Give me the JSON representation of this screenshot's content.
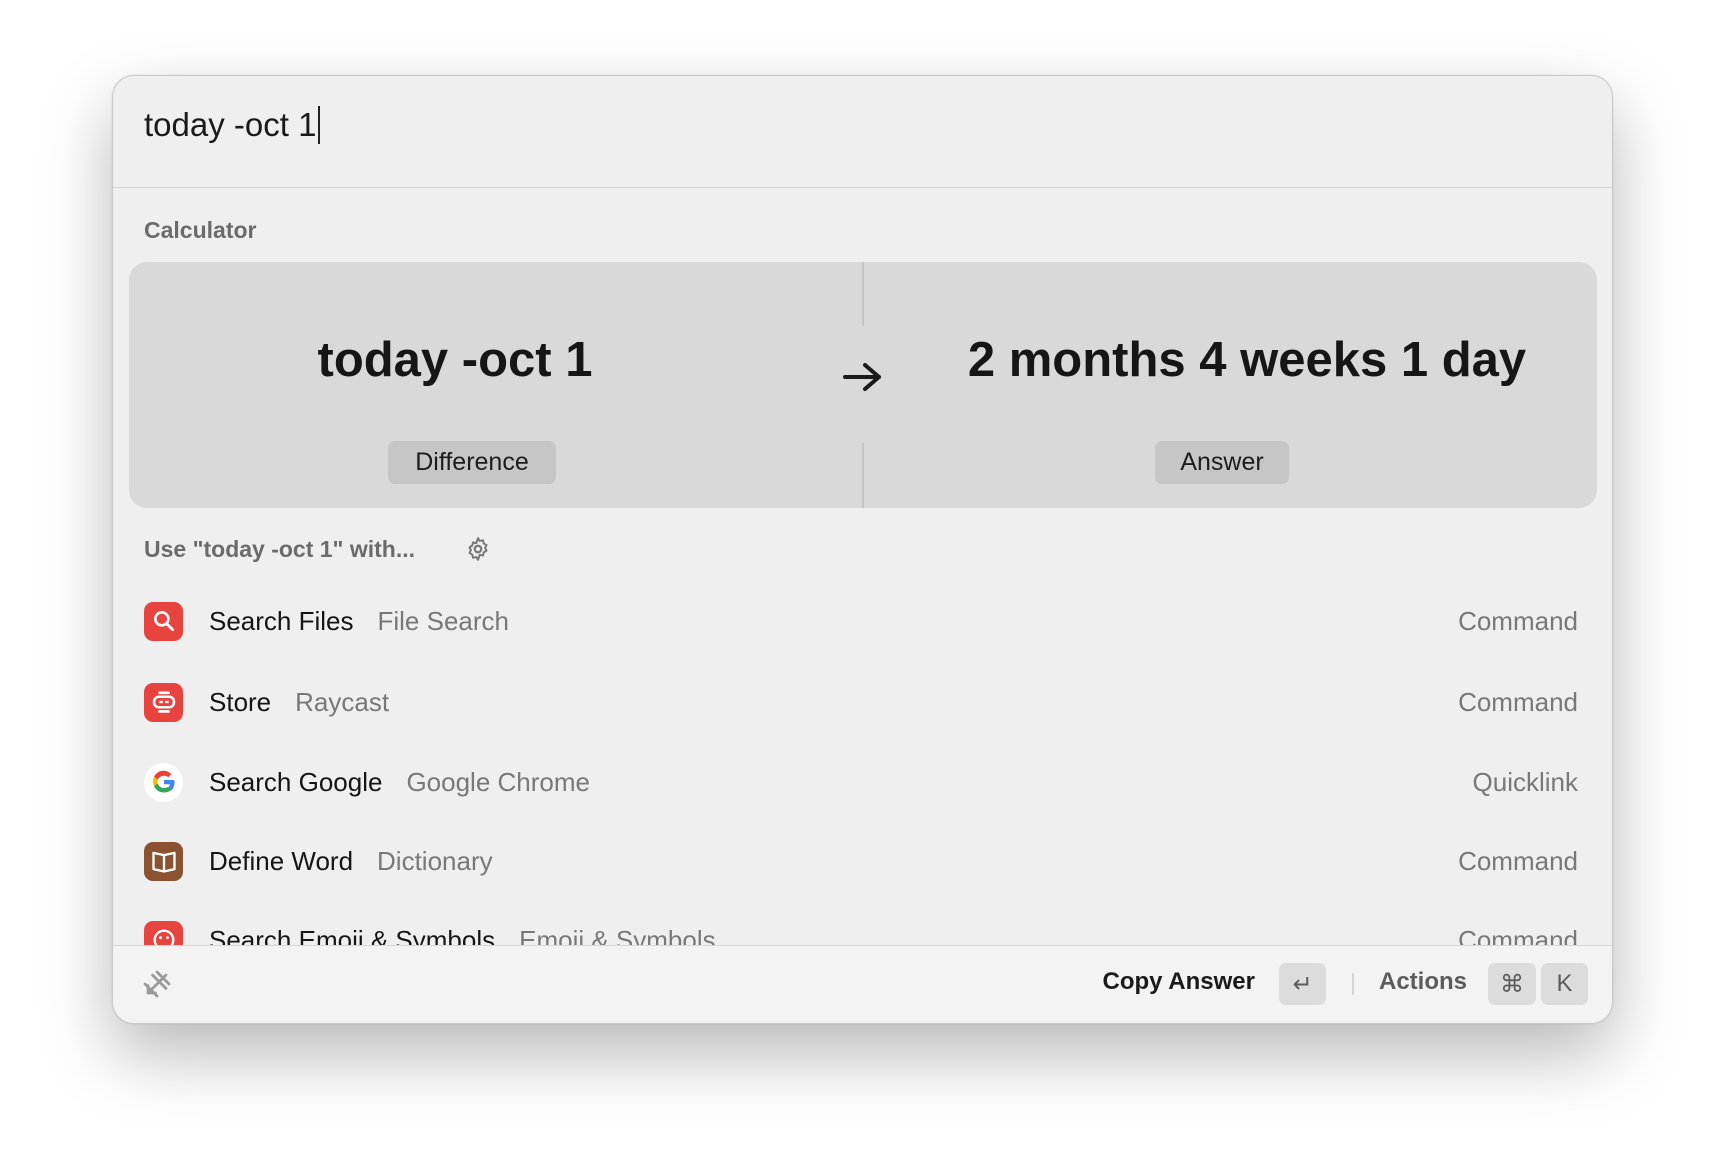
{
  "search": {
    "query": "today -oct 1"
  },
  "calculator": {
    "section_label": "Calculator",
    "expression": "today -oct 1",
    "expression_label": "Difference",
    "result": "2 months 4 weeks 1 day",
    "result_label": "Answer"
  },
  "fallback": {
    "label": "Use \"today -oct 1\" with..."
  },
  "items": [
    {
      "title": "Search Files",
      "subtitle": "File Search",
      "kind": "Command",
      "icon": "search-files-icon",
      "color": "#e8443f"
    },
    {
      "title": "Store",
      "subtitle": "Raycast",
      "kind": "Command",
      "icon": "store-icon",
      "color": "#e8443f"
    },
    {
      "title": "Search Google",
      "subtitle": "Google Chrome",
      "kind": "Quicklink",
      "icon": "google-icon",
      "color": "#ffffff"
    },
    {
      "title": "Define Word",
      "subtitle": "Dictionary",
      "kind": "Command",
      "icon": "dictionary-icon",
      "color": "#8a5230"
    },
    {
      "title": "Search Emoji & Symbols",
      "subtitle": "Emoji & Symbols",
      "kind": "Command",
      "icon": "emoji-icon",
      "color": "#e8443f"
    }
  ],
  "footer": {
    "primary_action": "Copy Answer",
    "enter_key": "↵",
    "actions_label": "Actions",
    "cmd_key": "⌘",
    "k_key": "K"
  }
}
